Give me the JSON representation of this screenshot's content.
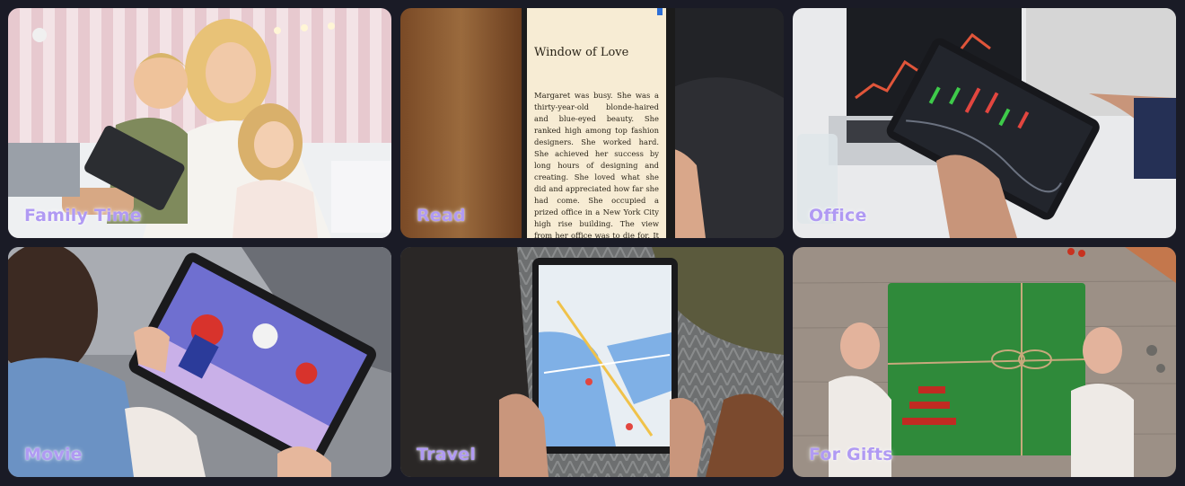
{
  "tiles": [
    {
      "id": "family",
      "caption": "Family Time"
    },
    {
      "id": "read",
      "caption": "Read"
    },
    {
      "id": "office",
      "caption": "Office"
    },
    {
      "id": "movie",
      "caption": "Movie"
    },
    {
      "id": "travel",
      "caption": "Travel"
    },
    {
      "id": "gifts",
      "caption": "For Gifts"
    }
  ],
  "reader": {
    "title": "Window of Love",
    "body": "Margaret was busy. She was a thirty-year-old blonde-haired and blue-eyed beauty. She ranked high among top fashion designers. She worked hard. She achieved her success by long hours of designing and creating. She loved what she did and appreciated how far she had come. She occupied a prized office in a New York City high rise building. The view from her office was to die for. It was magnificent and"
  },
  "colors": {
    "caption": "#b09af3",
    "frame": "#1a1b26"
  }
}
